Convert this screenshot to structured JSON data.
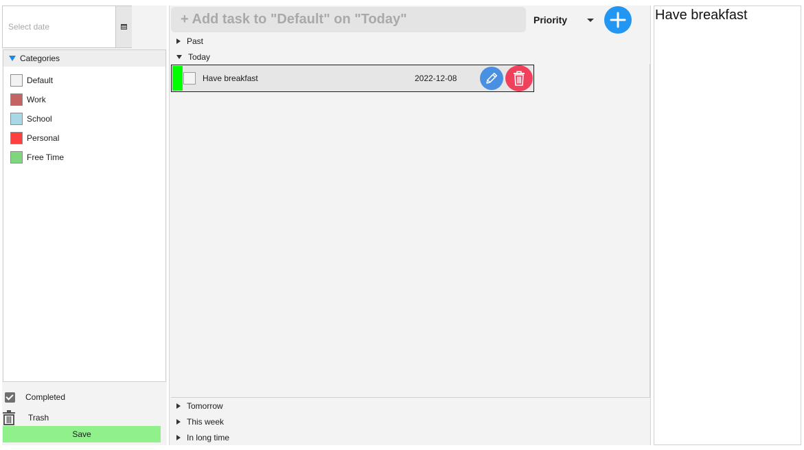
{
  "sidebar": {
    "date_placeholder": "Select date",
    "calendar_icon": "calendar-icon",
    "categories_header": "Categories",
    "categories": [
      {
        "label": "Default",
        "color": "#f2f2f2"
      },
      {
        "label": "Work",
        "color": "#c46462"
      },
      {
        "label": "School",
        "color": "#a8d8e6"
      },
      {
        "label": "Personal",
        "color": "#ff4040"
      },
      {
        "label": "Free Time",
        "color": "#7fd67d"
      }
    ],
    "completed_label": "Completed",
    "trash_label": "Trash",
    "save_label": "Save"
  },
  "main": {
    "add_task_placeholder": "+ Add task to \"Default\" on \"Today\"",
    "sort_label": "Priority",
    "add_button_icon": "plus-icon",
    "groups": {
      "past": "Past",
      "today": "Today",
      "tomorrow": "Tomorrow",
      "this_week": "This week",
      "long_time": "In long time"
    },
    "tasks": [
      {
        "title": "Have breakfast",
        "date": "2022-12-08",
        "priority_color": "#00ff00",
        "completed": false
      }
    ]
  },
  "detail": {
    "title": "Have breakfast"
  },
  "colors": {
    "accent_blue": "#2196f3",
    "edit_blue": "#4a90e2",
    "delete_red": "#f0405b",
    "save_green": "#8ff08c"
  }
}
